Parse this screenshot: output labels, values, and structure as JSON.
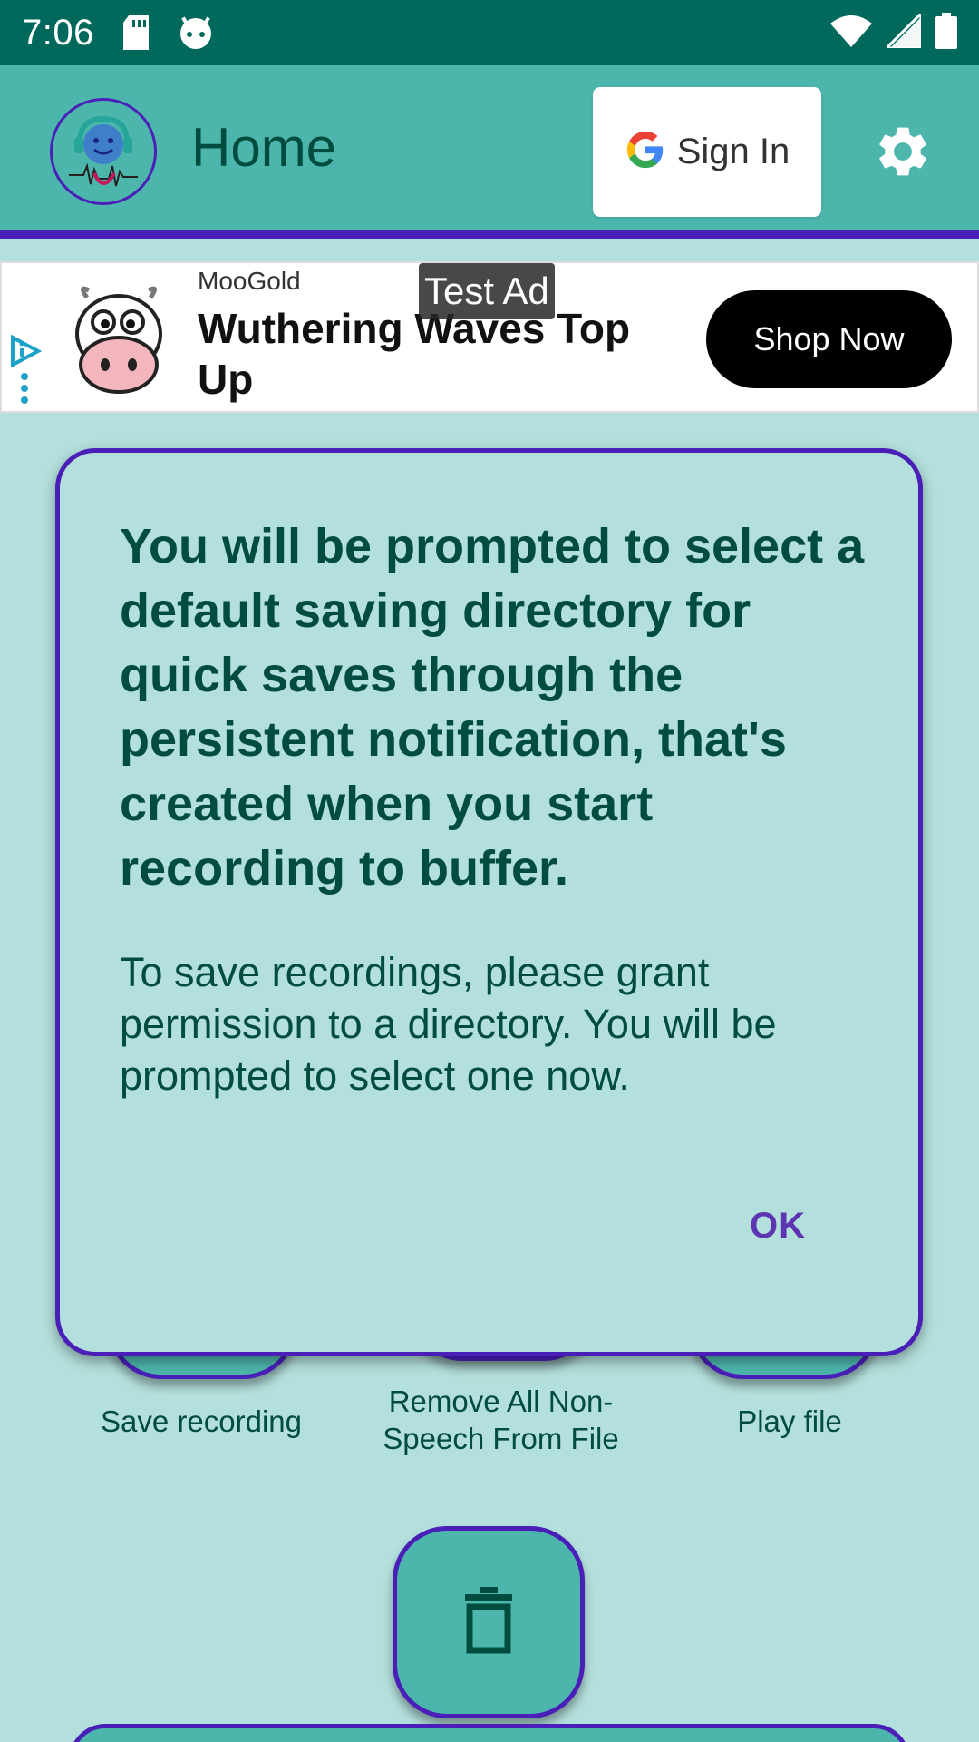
{
  "status_bar": {
    "time": "7:06",
    "icons": [
      "sd-card-icon",
      "android-icon",
      "wifi-icon",
      "signal-icon",
      "battery-icon"
    ]
  },
  "app_bar": {
    "title": "Home",
    "sign_in_label": "Sign In",
    "settings_icon": "gear-icon",
    "logo": "headphones-face-logo"
  },
  "ad": {
    "label": "Test Ad",
    "advertiser": "MooGold",
    "headline": "Wuthering Waves Top Up",
    "cta": "Shop Now"
  },
  "background_actions": {
    "save_recording": "Save recording",
    "remove_non_speech": "Remove All Non-Speech From File",
    "play_file": "Play file",
    "delete_icon": "trash-icon"
  },
  "dialog": {
    "title": "You will be prompted to select a default saving directory for quick saves through the persistent notification, that's created when you start recording to buffer.",
    "body": "To save recordings, please grant permission to a directory. You will be prompted to select one now.",
    "ok_label": "OK"
  },
  "colors": {
    "status_bar": "#00695c",
    "app_bar": "#4db6ac",
    "accent_border": "#4a1fb8",
    "background": "#b3dfdc",
    "text_primary": "#004d40",
    "dialog_button": "#5e35b1"
  }
}
